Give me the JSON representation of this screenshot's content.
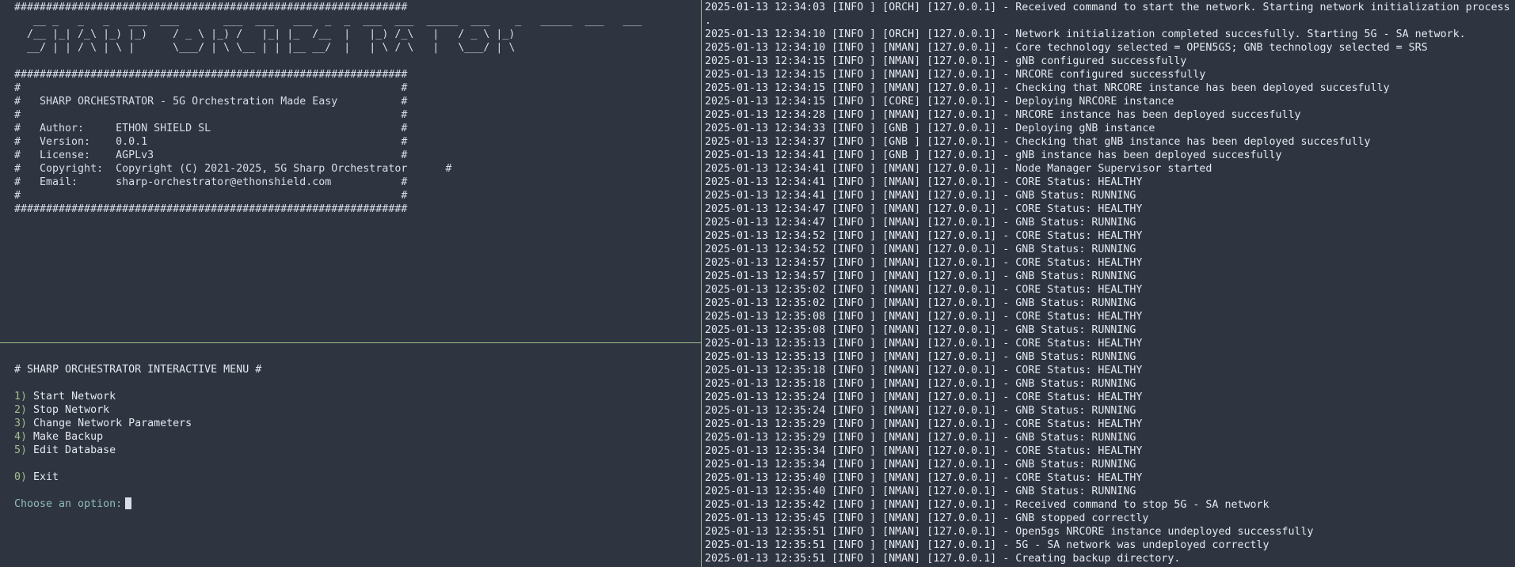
{
  "banner": {
    "lines": [
      "##############################################################",
      "   __ _   _   _   ___  ___       ___  ___   ___  _  _  ___  ___  _____  ___    _   _____  ___   ___",
      "  /__ |_| /_\\ |_) |_)    / _ \\ |_) /   |_| |_  /__  |   |_) /_\\   |   / _ \\ |_)",
      "  __/ | | / \\ | \\ |      \\___/ | \\ \\__ | | |__ __/  |   | \\ / \\   |   \\___/ | \\",
      "",
      "##############################################################",
      "#                                                            #",
      "#   SHARP ORCHESTRATOR - 5G Orchestration Made Easy          #",
      "#                                                            #",
      "#   Author:     ETHON SHIELD SL                              #",
      "#   Version:    0.0.1                                        #",
      "#   License:    AGPLv3                                       #",
      "#   Copyright:  Copyright (C) 2021-2025, 5G Sharp Orchestrator      #",
      "#   Email:      sharp-orchestrator@ethonshield.com           #",
      "#                                                            #",
      "##############################################################"
    ]
  },
  "menu": {
    "title": "# SHARP ORCHESTRATOR INTERACTIVE MENU #",
    "options": [
      {
        "num": "1)",
        "label": "Start Network"
      },
      {
        "num": "2)",
        "label": "Stop Network"
      },
      {
        "num": "3)",
        "label": "Change Network Parameters"
      },
      {
        "num": "4)",
        "label": "Make Backup"
      },
      {
        "num": "5)",
        "label": "Edit Database"
      }
    ],
    "exit": {
      "num": "0)",
      "label": "Exit"
    },
    "prompt": "Choose an option:"
  },
  "log": {
    "lines": [
      "2025-01-13 12:34:03 [INFO ] [ORCH] [127.0.0.1] - Received command to start the network. Starting network initialization process",
      ".",
      "2025-01-13 12:34:10 [INFO ] [ORCH] [127.0.0.1] - Network initialization completed succesfully. Starting 5G - SA network.",
      "2025-01-13 12:34:10 [INFO ] [NMAN] [127.0.0.1] - Core technology selected = OPEN5GS; GNB technology selected = SRS",
      "2025-01-13 12:34:15 [INFO ] [NMAN] [127.0.0.1] - gNB configured successfully",
      "2025-01-13 12:34:15 [INFO ] [NMAN] [127.0.0.1] - NRCORE configured successfully",
      "2025-01-13 12:34:15 [INFO ] [NMAN] [127.0.0.1] - Checking that NRCORE instance has been deployed succesfully",
      "2025-01-13 12:34:15 [INFO ] [CORE] [127.0.0.1] - Deploying NRCORE instance",
      "2025-01-13 12:34:28 [INFO ] [NMAN] [127.0.0.1] - NRCORE instance has been deployed succesfully",
      "2025-01-13 12:34:33 [INFO ] [GNB ] [127.0.0.1] - Deploying gNB instance",
      "2025-01-13 12:34:37 [INFO ] [GNB ] [127.0.0.1] - Checking that gNB instance has been deployed succesfully",
      "2025-01-13 12:34:41 [INFO ] [GNB ] [127.0.0.1] - gNB instance has been deployed succesfully",
      "2025-01-13 12:34:41 [INFO ] [NMAN] [127.0.0.1] - Node Manager Supervisor started",
      "2025-01-13 12:34:41 [INFO ] [NMAN] [127.0.0.1] - CORE Status: HEALTHY",
      "2025-01-13 12:34:41 [INFO ] [NMAN] [127.0.0.1] - GNB Status: RUNNING",
      "2025-01-13 12:34:47 [INFO ] [NMAN] [127.0.0.1] - CORE Status: HEALTHY",
      "2025-01-13 12:34:47 [INFO ] [NMAN] [127.0.0.1] - GNB Status: RUNNING",
      "2025-01-13 12:34:52 [INFO ] [NMAN] [127.0.0.1] - CORE Status: HEALTHY",
      "2025-01-13 12:34:52 [INFO ] [NMAN] [127.0.0.1] - GNB Status: RUNNING",
      "2025-01-13 12:34:57 [INFO ] [NMAN] [127.0.0.1] - CORE Status: HEALTHY",
      "2025-01-13 12:34:57 [INFO ] [NMAN] [127.0.0.1] - GNB Status: RUNNING",
      "2025-01-13 12:35:02 [INFO ] [NMAN] [127.0.0.1] - CORE Status: HEALTHY",
      "2025-01-13 12:35:02 [INFO ] [NMAN] [127.0.0.1] - GNB Status: RUNNING",
      "2025-01-13 12:35:08 [INFO ] [NMAN] [127.0.0.1] - CORE Status: HEALTHY",
      "2025-01-13 12:35:08 [INFO ] [NMAN] [127.0.0.1] - GNB Status: RUNNING",
      "2025-01-13 12:35:13 [INFO ] [NMAN] [127.0.0.1] - CORE Status: HEALTHY",
      "2025-01-13 12:35:13 [INFO ] [NMAN] [127.0.0.1] - GNB Status: RUNNING",
      "2025-01-13 12:35:18 [INFO ] [NMAN] [127.0.0.1] - CORE Status: HEALTHY",
      "2025-01-13 12:35:18 [INFO ] [NMAN] [127.0.0.1] - GNB Status: RUNNING",
      "2025-01-13 12:35:24 [INFO ] [NMAN] [127.0.0.1] - CORE Status: HEALTHY",
      "2025-01-13 12:35:24 [INFO ] [NMAN] [127.0.0.1] - GNB Status: RUNNING",
      "2025-01-13 12:35:29 [INFO ] [NMAN] [127.0.0.1] - CORE Status: HEALTHY",
      "2025-01-13 12:35:29 [INFO ] [NMAN] [127.0.0.1] - GNB Status: RUNNING",
      "2025-01-13 12:35:34 [INFO ] [NMAN] [127.0.0.1] - CORE Status: HEALTHY",
      "2025-01-13 12:35:34 [INFO ] [NMAN] [127.0.0.1] - GNB Status: RUNNING",
      "2025-01-13 12:35:40 [INFO ] [NMAN] [127.0.0.1] - CORE Status: HEALTHY",
      "2025-01-13 12:35:40 [INFO ] [NMAN] [127.0.0.1] - GNB Status: RUNNING",
      "2025-01-13 12:35:42 [INFO ] [NMAN] [127.0.0.1] - Received command to stop 5G - SA network",
      "2025-01-13 12:35:45 [INFO ] [NMAN] [127.0.0.1] - GNB stopped correctly",
      "2025-01-13 12:35:51 [INFO ] [NMAN] [127.0.0.1] - Open5gs NRCORE instance undeployed successfully",
      "2025-01-13 12:35:51 [INFO ] [NMAN] [127.0.0.1] - 5G - SA network was undeployed correctly",
      "2025-01-13 12:35:51 [INFO ] [NMAN] [127.0.0.1] - Creating backup directory."
    ]
  },
  "colors": {
    "background": "#2e3440",
    "text": "#e5e9f0",
    "divider": "#a3be8c",
    "menu_number": "#a3be8c",
    "prompt": "#8fbcbb"
  }
}
